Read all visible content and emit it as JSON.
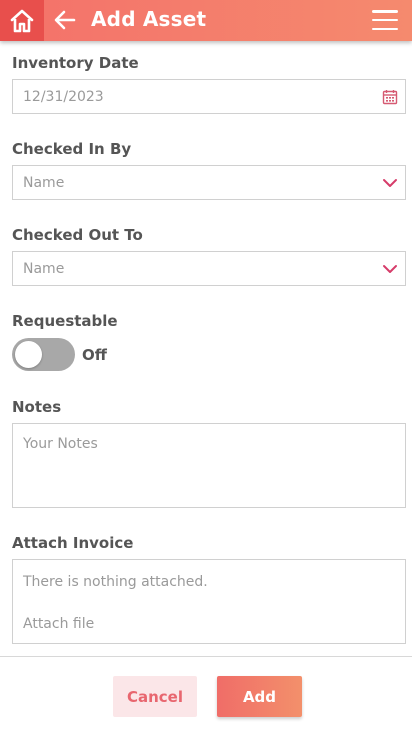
{
  "appbar": {
    "title": "Add Asset",
    "home_icon": "home-icon",
    "back_icon": "arrow-left-icon",
    "menu_icon": "hamburger-menu-icon",
    "color_start": "#f4716a",
    "color_end": "#f58a6e"
  },
  "form": {
    "inventory_date": {
      "label": "Inventory Date",
      "value": "12/31/2023",
      "icon": "calendar-icon"
    },
    "checked_in_by": {
      "label": "Checked In By",
      "placeholder": "Name",
      "icon": "chevron-down-icon"
    },
    "checked_out_to": {
      "label": "Checked Out To",
      "placeholder": "Name",
      "icon": "chevron-down-icon"
    },
    "requestable": {
      "label": "Requestable",
      "state": "Off"
    },
    "notes": {
      "label": "Notes",
      "placeholder": "Your Notes"
    },
    "attach_invoice": {
      "label": "Attach Invoice",
      "empty_text": "There is nothing attached.",
      "attach_label": "Attach file"
    }
  },
  "actions": {
    "cancel_label": "Cancel",
    "add_label": "Add"
  }
}
